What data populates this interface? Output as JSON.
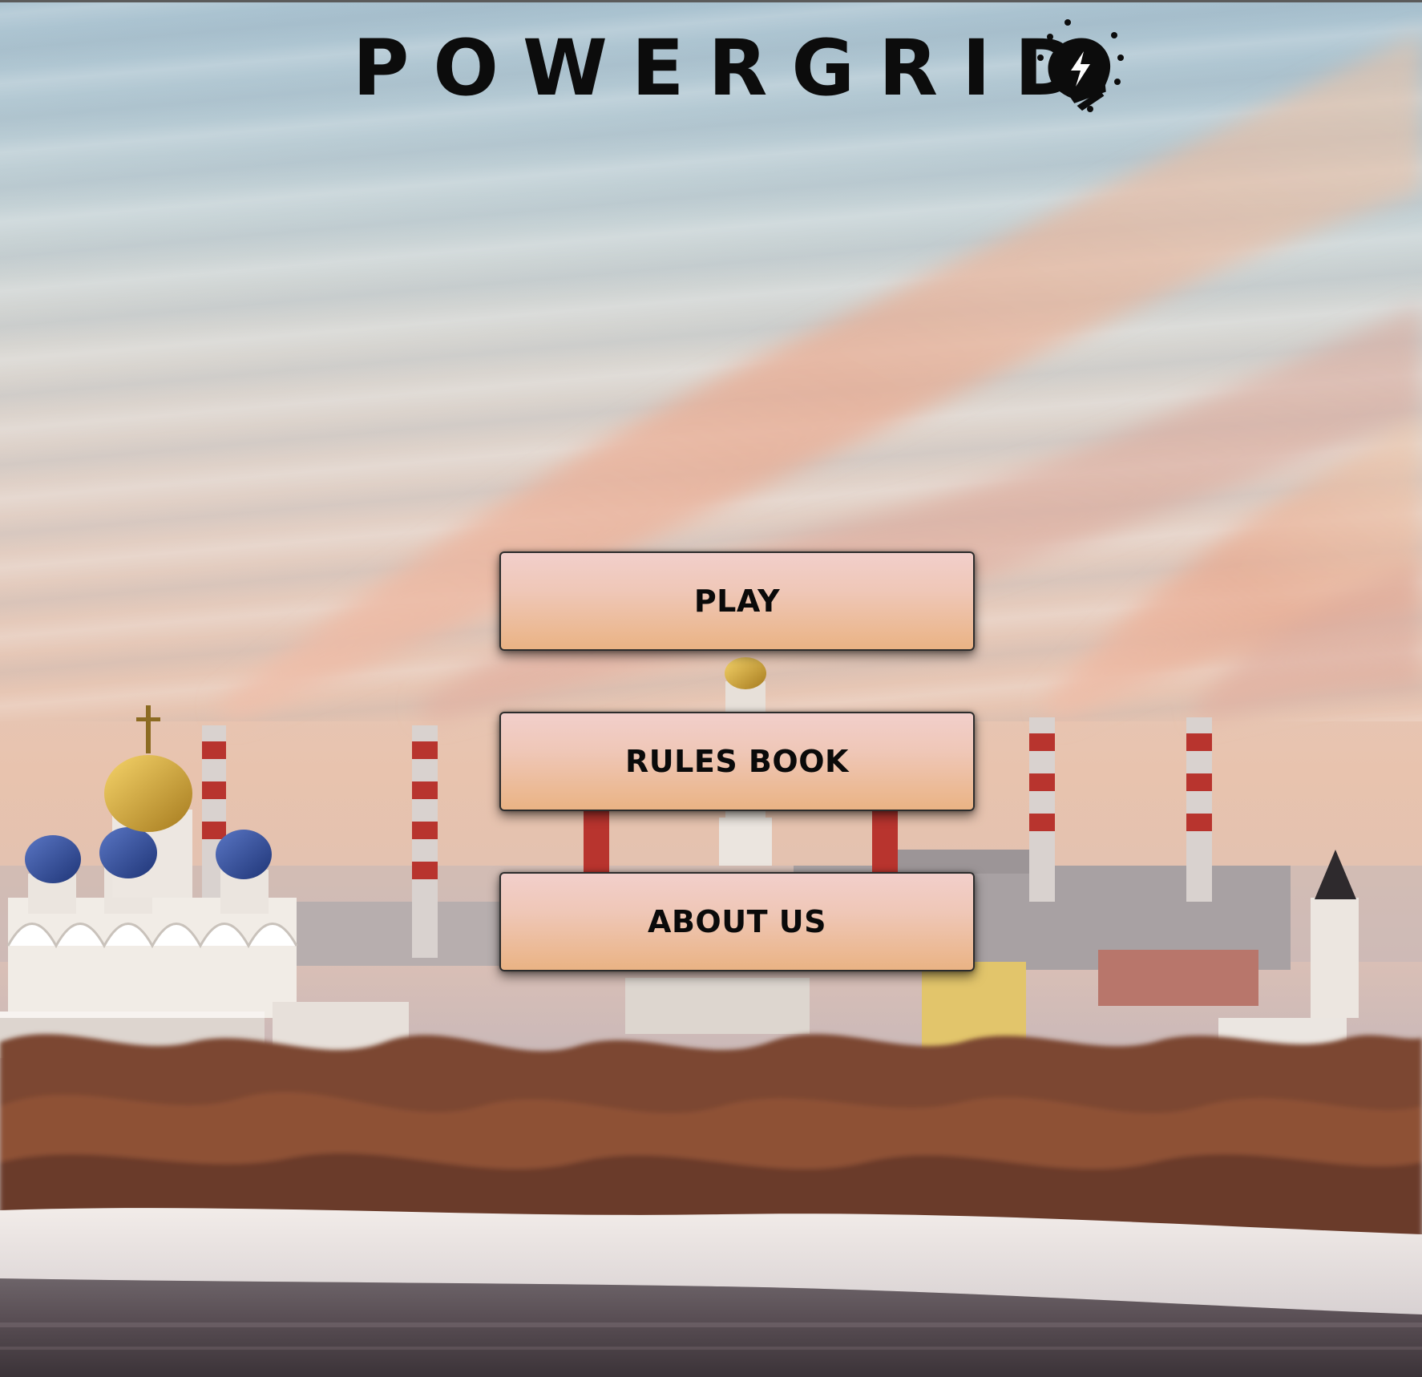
{
  "title": {
    "text": "POWERGRID",
    "icon": "lightbulb-bolt-icon"
  },
  "menu": {
    "play_label": "PLAY",
    "rules_label": "RULES BOOK",
    "about_label": "ABOUT US"
  },
  "background": {
    "scene": "winter landscape with power plant smokestacks, onion-domed cathedral, snowy riverbank",
    "colors": {
      "sky_top": "#a9c2d0",
      "sky_warm": "#e8c3ae",
      "smoke": "#e9b9a5",
      "button_top": "#f2cfcb",
      "button_bottom": "#eab384"
    }
  }
}
